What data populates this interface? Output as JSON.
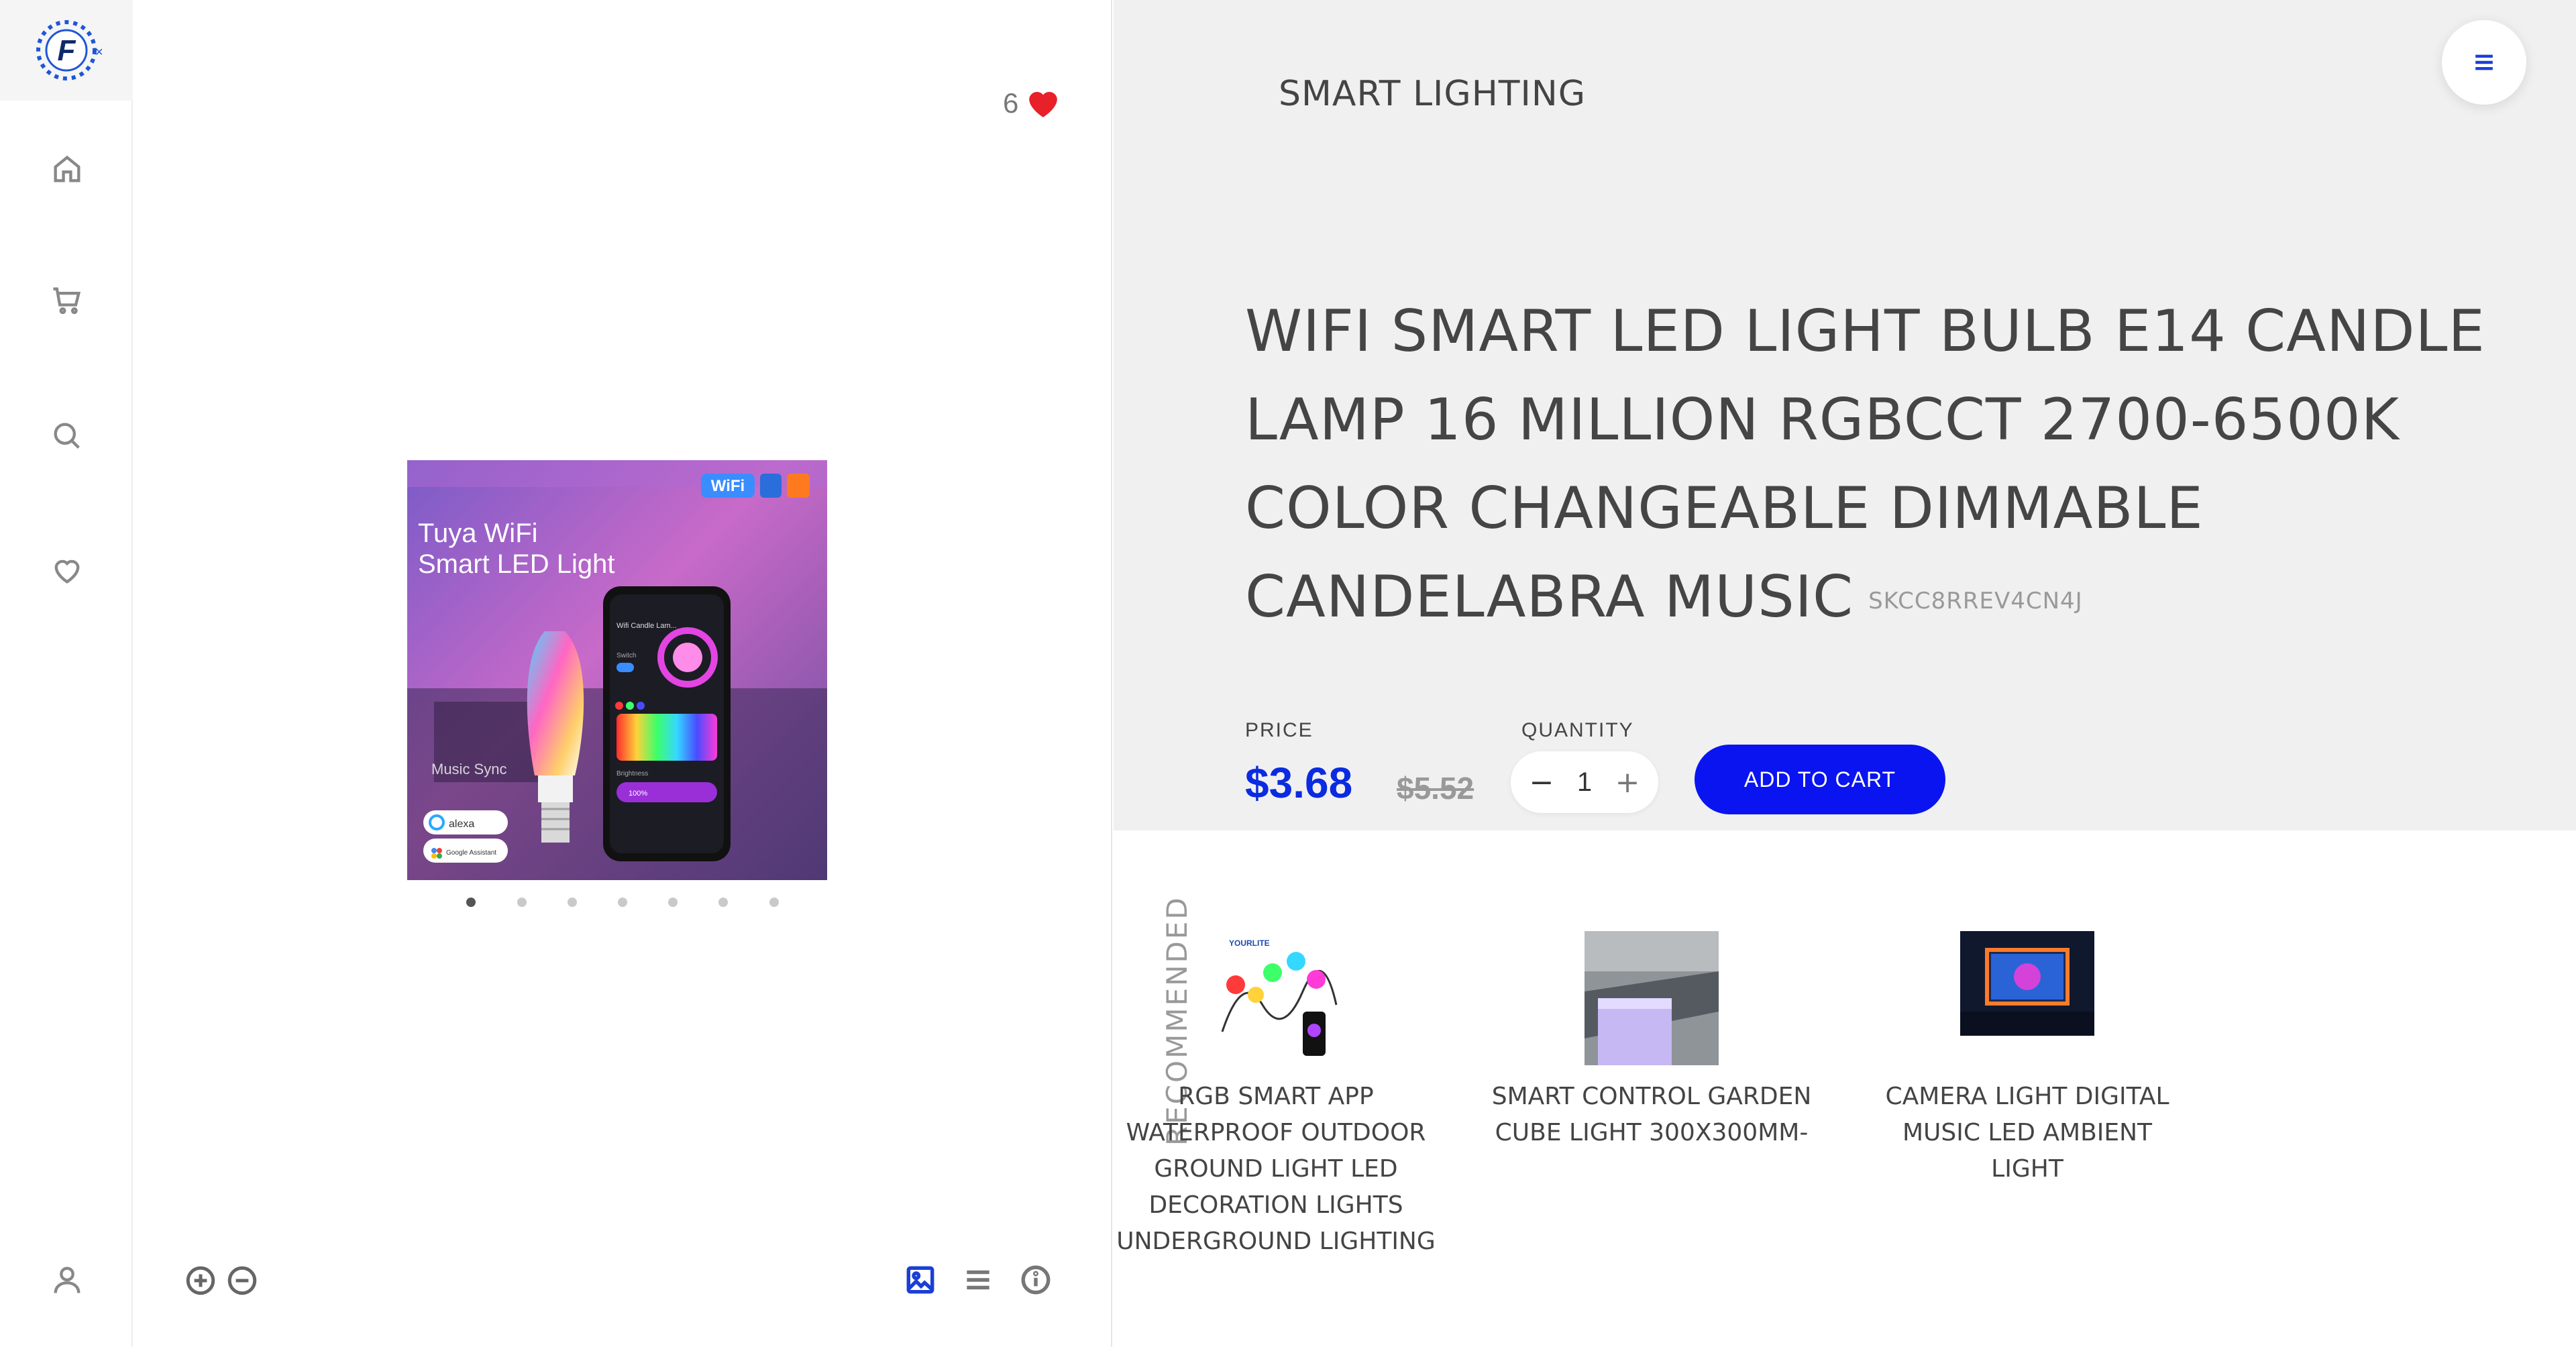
{
  "sidebar": {
    "logo_letter": "F",
    "nav": [
      {
        "name": "home",
        "icon": "home-icon"
      },
      {
        "name": "cart",
        "icon": "cart-icon"
      },
      {
        "name": "search",
        "icon": "search-icon"
      },
      {
        "name": "wishlist",
        "icon": "heart-icon"
      },
      {
        "name": "account",
        "icon": "user-icon"
      }
    ]
  },
  "gallery": {
    "likes_count": "6",
    "image": {
      "title_line1": "Tuya WiFi",
      "title_line2": "Smart LED Light",
      "badge_wifi": "WiFi",
      "music_sync": "Music Sync",
      "alexa": "alexa",
      "google": "Google Assistant",
      "app_title": "Wifi Candle Lam...",
      "app_brightness": "Brightness",
      "app_switch": "Switch",
      "app_percent": "100%"
    },
    "dots_total": 7,
    "dots_active_index": 0
  },
  "details": {
    "category": "SMART LIGHTING",
    "title": "WIFI SMART LED LIGHT BULB E14 CANDLE LAMP 16 MILLION RGBCCT 2700-6500K COLOR CHANGEABLE DIMMABLE CANDELABRA MUSIC",
    "sku": "SKCC8RREV4CN4J",
    "price_label": "PRICE",
    "price": "$3.68",
    "old_price": "$5.52",
    "quantity_label": "QUANTITY",
    "quantity": "1",
    "minus": "−",
    "plus": "+",
    "add_to_cart": "ADD TO CART"
  },
  "recommended": {
    "label": "RECOMMENDED",
    "items": [
      {
        "name": "RGB SMART APP WATERPROOF OUTDOOR GROUND LIGHT LED DECORATION LIGHTS UNDERGROUND LIGHTING",
        "thumb_brand": "YOURLITE"
      },
      {
        "name": "SMART CONTROL GARDEN CUBE LIGHT 300X300MM-"
      },
      {
        "name": "CAMERA LIGHT DIGITAL MUSIC LED AMBIENT LIGHT"
      }
    ]
  },
  "colors": {
    "accent": "#0a14f0",
    "price": "#0a2be0",
    "heart": "#e8202a",
    "panel_bg": "#f0f0f0"
  }
}
